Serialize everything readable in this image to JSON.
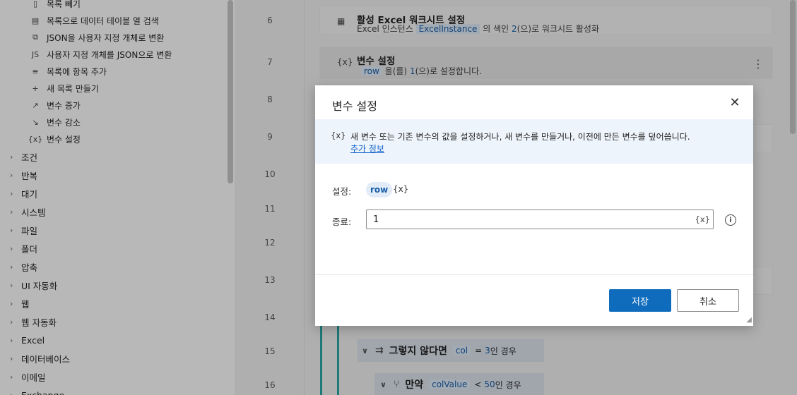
{
  "left_panel": {
    "subitems": [
      {
        "label": "목록 빼기",
        "icon": "list-subtract-icon"
      },
      {
        "label": "목록으로 데이터 테이블 열 검색",
        "icon": "table-search-icon"
      },
      {
        "label": "JSON을 사용자 지정 개체로 변환",
        "icon": "json-convert-icon"
      },
      {
        "label": "사용자 지정 개체를 JSON으로 변환",
        "icon": "js-file-icon"
      },
      {
        "label": "목록에 항목 추가",
        "icon": "list-add-icon"
      },
      {
        "label": "새 목록 만들기",
        "icon": "plus-icon"
      },
      {
        "label": "변수 증가",
        "icon": "trend-up-icon"
      },
      {
        "label": "변수 감소",
        "icon": "trend-down-icon"
      },
      {
        "label": "변수 설정",
        "icon": "variable-icon"
      }
    ],
    "categories": [
      "조건",
      "반복",
      "대기",
      "시스템",
      "파일",
      "폴더",
      "압축",
      "UI 자동화",
      "웹",
      "웹 자동화",
      "Excel",
      "데이터베이스",
      "이메일",
      "Exchange"
    ]
  },
  "flow": {
    "line_numbers": [
      "6",
      "7",
      "8",
      "9",
      "10",
      "11",
      "12",
      "13",
      "14",
      "15",
      "16"
    ],
    "step6": {
      "title": "활성 Excel 워크시트 설정",
      "desc_prefix": "Excel 인스턴스",
      "instance": "ExcelInstance",
      "desc_mid": "의 색인",
      "index": "2",
      "desc_suffix": "(으)로 워크시트 활성화"
    },
    "step7": {
      "icon_text": "{x}",
      "title": "변수 설정",
      "var": "row",
      "desc_mid": "을(를)",
      "value": "1",
      "desc_suffix": "(으)로 설정합니다."
    },
    "step15": {
      "keyword": "그렇지 않다면",
      "var": "col",
      "op": "=",
      "value": "3",
      "suffix": "인 경우"
    },
    "step16": {
      "keyword": "만약",
      "var": "colValue",
      "op": "<",
      "value": "50",
      "suffix": "인 경우"
    }
  },
  "dialog": {
    "title": "변수 설정",
    "info_icon": "{x}",
    "info_text": "새 변수 또는 기존 변수의 값을 설정하거나, 새 변수를 만들거나, 이전에 만든 변수를 덮어씁니다.",
    "info_link": "추가 정보",
    "set_label": "설정:",
    "set_var": "row",
    "set_var_icon": "{x}",
    "to_label": "종료:",
    "to_value": "1",
    "to_icon": "{x}",
    "save": "저장",
    "cancel": "취소"
  }
}
